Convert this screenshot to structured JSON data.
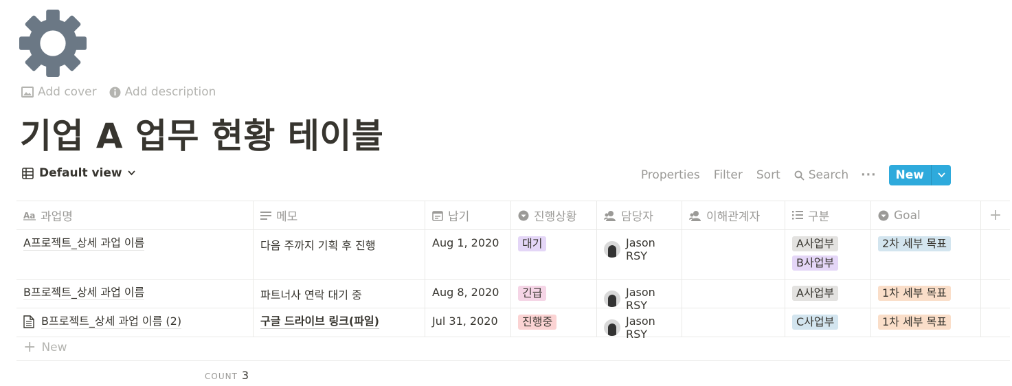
{
  "page": {
    "icon": "gear-icon",
    "add_cover": "Add cover",
    "add_description": "Add description",
    "title": "기업 A 업무 현황 테이블"
  },
  "view": {
    "label": "Default view"
  },
  "toolbar": {
    "properties": "Properties",
    "filter": "Filter",
    "sort": "Sort",
    "search": "Search",
    "more": "···",
    "new": "New"
  },
  "columns": [
    {
      "label": "과업명",
      "icon": "title-aa-icon"
    },
    {
      "label": "메모",
      "icon": "text-lines-icon"
    },
    {
      "label": "납기",
      "icon": "calendar-icon"
    },
    {
      "label": "진행상황",
      "icon": "select-circle-icon"
    },
    {
      "label": "담당자",
      "icon": "person-icon"
    },
    {
      "label": "이해관계자",
      "icon": "person-icon"
    },
    {
      "label": "구분",
      "icon": "list-icon"
    },
    {
      "label": "Goal",
      "icon": "select-circle-icon"
    }
  ],
  "rows": [
    {
      "name": "A프로젝트_상세 과업 이름",
      "memo": "다음 주까지 기획 후 진행",
      "due": "Aug 1, 2020",
      "status": "대기",
      "owner": "Jason RSY",
      "category": [
        "A사업부",
        "B사업부"
      ],
      "goal": "2차 세부 목표"
    },
    {
      "name": "B프로젝트_상세 과업 이름",
      "memo": "파트너사 연락 대기 중",
      "due": "Aug 8, 2020",
      "status": "긴급",
      "owner": "Jason RSY",
      "category": [
        "A사업부"
      ],
      "goal": "1차 세부 목표"
    },
    {
      "name": "B프로젝트_상세 과업 이름 (2)",
      "memo": "구글 드라이브 링크(파일)",
      "due": "Jul 31, 2020",
      "status": "진행중",
      "owner": "Jason RSY",
      "category": [
        "C사업부"
      ],
      "goal": "1차 세부 목표"
    }
  ],
  "new_row": "New",
  "footer": {
    "count_label": "COUNT",
    "count_value": "3"
  },
  "colors": {
    "tag_purple": "#e4d6f7",
    "tag_pink": "#f5d5e6",
    "tag_red": "#fbd3d3",
    "tag_gray": "#e3e2e0",
    "tag_blue": "#d3e5ef",
    "tag_orange": "#fadec9",
    "accent": "#2eaadc"
  }
}
